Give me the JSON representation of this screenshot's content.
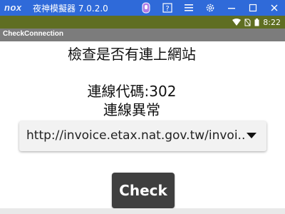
{
  "emulator": {
    "logo": "nox",
    "title": "夜神模擬器 7.0.2.0",
    "icons": [
      "phone-icon",
      "help-icon",
      "menu-icon",
      "settings-icon",
      "minimize-icon",
      "maximize-icon",
      "close-icon"
    ]
  },
  "status_bar": {
    "time": "8:22",
    "icons": [
      "wifi-icon",
      "no-sim-icon",
      "battery-icon"
    ]
  },
  "app": {
    "title": "CheckConnection",
    "heading": "檢查是否有連上網站",
    "code_line": "連線代碼:302",
    "status_line": "連線異常",
    "url_select": {
      "selected": "http://invoice.etax.nat.gov.tw/invoi.."
    },
    "check_button": "Check"
  }
}
